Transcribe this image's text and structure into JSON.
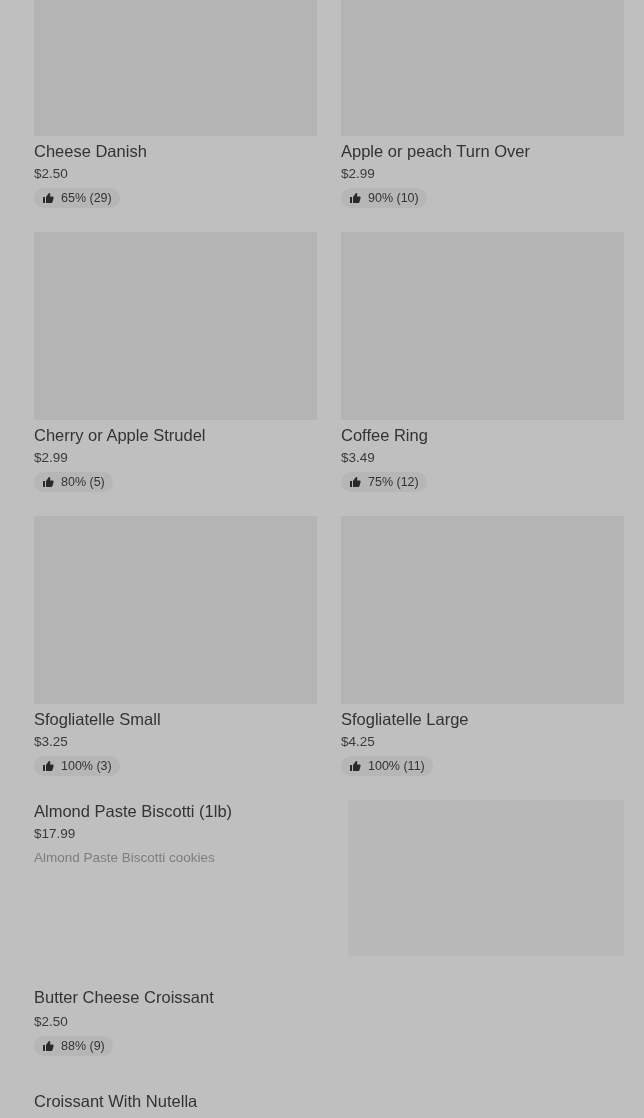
{
  "grid_items": [
    {
      "name": "Cheese Danish",
      "price": "$2.50",
      "rating": "65% (29)"
    },
    {
      "name": "Apple or peach Turn Over",
      "price": "$2.99",
      "rating": "90% (10)"
    },
    {
      "name": "Cherry or Apple Strudel",
      "price": "$2.99",
      "rating": "80% (5)"
    },
    {
      "name": "Coffee Ring",
      "price": "$3.49",
      "rating": "75% (12)"
    },
    {
      "name": "Sfogliatelle Small",
      "price": "$3.25",
      "rating": "100% (3)"
    },
    {
      "name": "Sfogliatelle Large",
      "price": "$4.25",
      "rating": "100% (11)"
    }
  ],
  "list_items": [
    {
      "name": "Almond Paste Biscotti (1lb)",
      "price": "$17.99",
      "description": "Almond Paste Biscotti cookies",
      "image": true
    },
    {
      "name": "Butter Cheese Croissant",
      "price": "$2.50",
      "rating": "88% (9)"
    },
    {
      "name": "Croissant With Nutella"
    }
  ]
}
